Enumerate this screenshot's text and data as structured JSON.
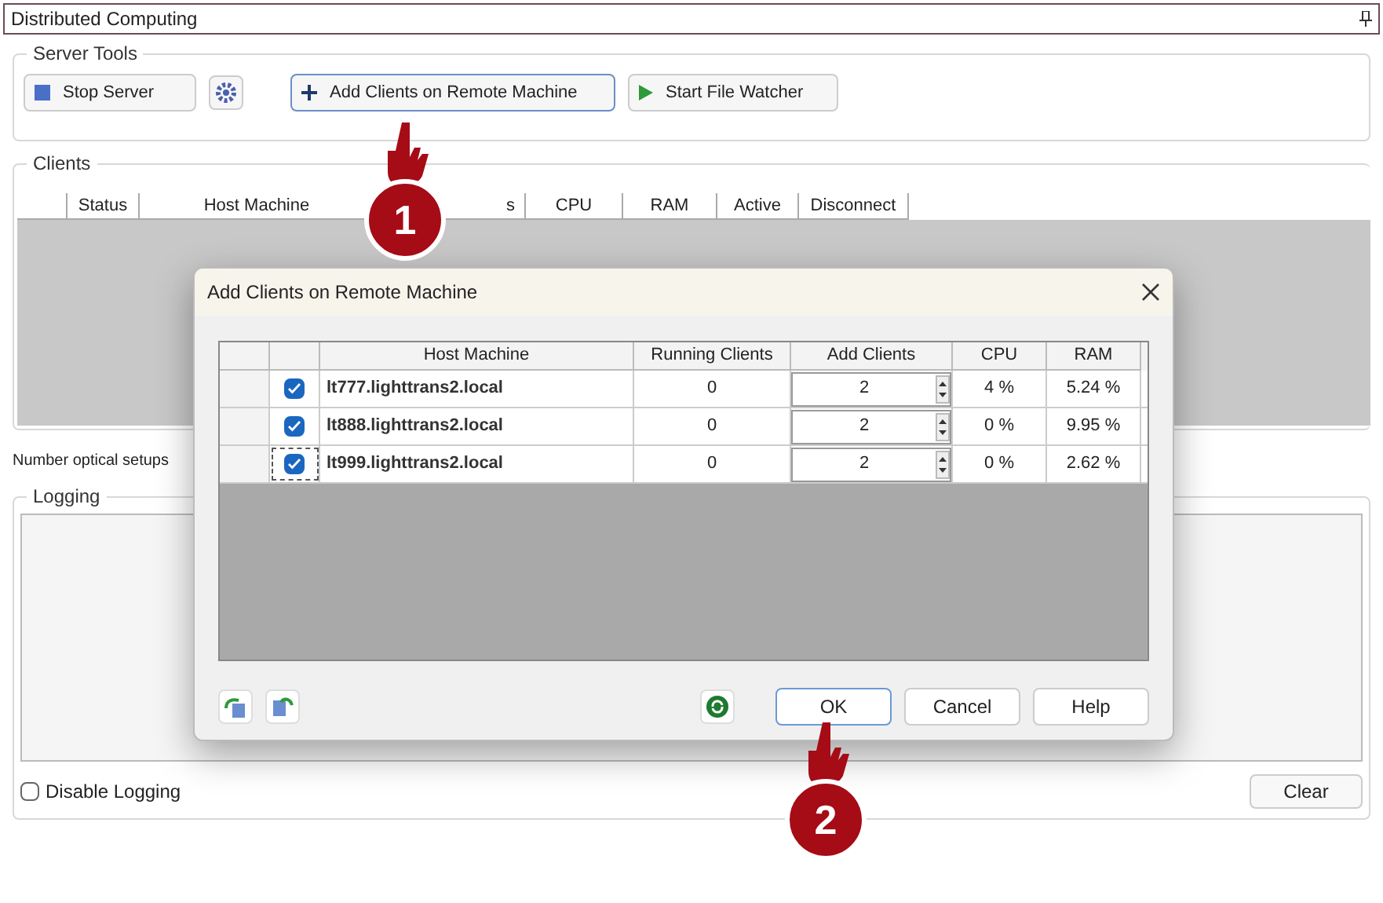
{
  "panel": {
    "title": "Distributed Computing"
  },
  "server_tools": {
    "title": "Server Tools",
    "buttons": [
      {
        "label": "Stop Server",
        "kind": "stop"
      },
      {
        "kind": "settings"
      },
      {
        "label": "Add Clients on Remote Machine",
        "kind": "add"
      },
      {
        "label": "Start File Watcher",
        "kind": "play"
      }
    ]
  },
  "clients": {
    "title": "Clients",
    "columns": [
      "",
      "Status",
      "Host Machine",
      "s",
      "CPU",
      "RAM",
      "Active",
      "Disconnect"
    ]
  },
  "number_optical_setups": {
    "label": "Number optical setups"
  },
  "logging": {
    "title": "Logging",
    "disable_logging": {
      "label": "Disable Logging",
      "checked": false
    },
    "clear_button": "Clear"
  },
  "dialog": {
    "title": "Add Clients on Remote Machine",
    "columns": [
      "",
      "",
      "Host Machine",
      "Running Clients",
      "Add Clients",
      "CPU",
      "RAM"
    ],
    "rows": [
      {
        "checked": true,
        "focused": false,
        "host": "lt777.lighttrans2.local",
        "running": "0",
        "add": "2",
        "cpu": "4 %",
        "ram": "5.24 %"
      },
      {
        "checked": true,
        "focused": false,
        "host": "lt888.lighttrans2.local",
        "running": "0",
        "add": "2",
        "cpu": "0 %",
        "ram": "9.95 %"
      },
      {
        "checked": true,
        "focused": true,
        "host": "lt999.lighttrans2.local",
        "running": "0",
        "add": "2",
        "cpu": "0 %",
        "ram": "2.62 %"
      }
    ],
    "buttons": [
      {
        "label": "OK",
        "selected": true
      },
      {
        "label": "Cancel",
        "selected": false
      },
      {
        "label": "Help",
        "selected": false
      }
    ]
  },
  "steps": [
    {
      "number": "1"
    },
    {
      "number": "2"
    }
  ]
}
